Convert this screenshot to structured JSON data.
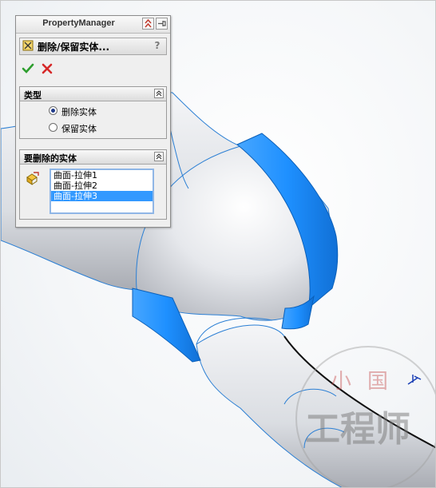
{
  "property_manager": {
    "title": "PropertyManager",
    "feature_name": "删除/保留实体...",
    "help_label": "?",
    "type_group": {
      "title": "类型",
      "options": [
        {
          "label": "删除实体",
          "checked": true
        },
        {
          "label": "保留实体",
          "checked": false
        }
      ]
    },
    "bodies_group": {
      "title": "要删除的实体",
      "items": [
        {
          "label": "曲面-拉伸1",
          "selected": false
        },
        {
          "label": "曲面-拉伸2",
          "selected": false
        },
        {
          "label": "曲面-拉伸3",
          "selected": true
        }
      ]
    }
  },
  "viewport": {
    "highlight_color": "#1e90ff",
    "edge_color": "#1a6fd0"
  },
  "watermark": {
    "top_text": "小国",
    "main_text": "工程师"
  }
}
